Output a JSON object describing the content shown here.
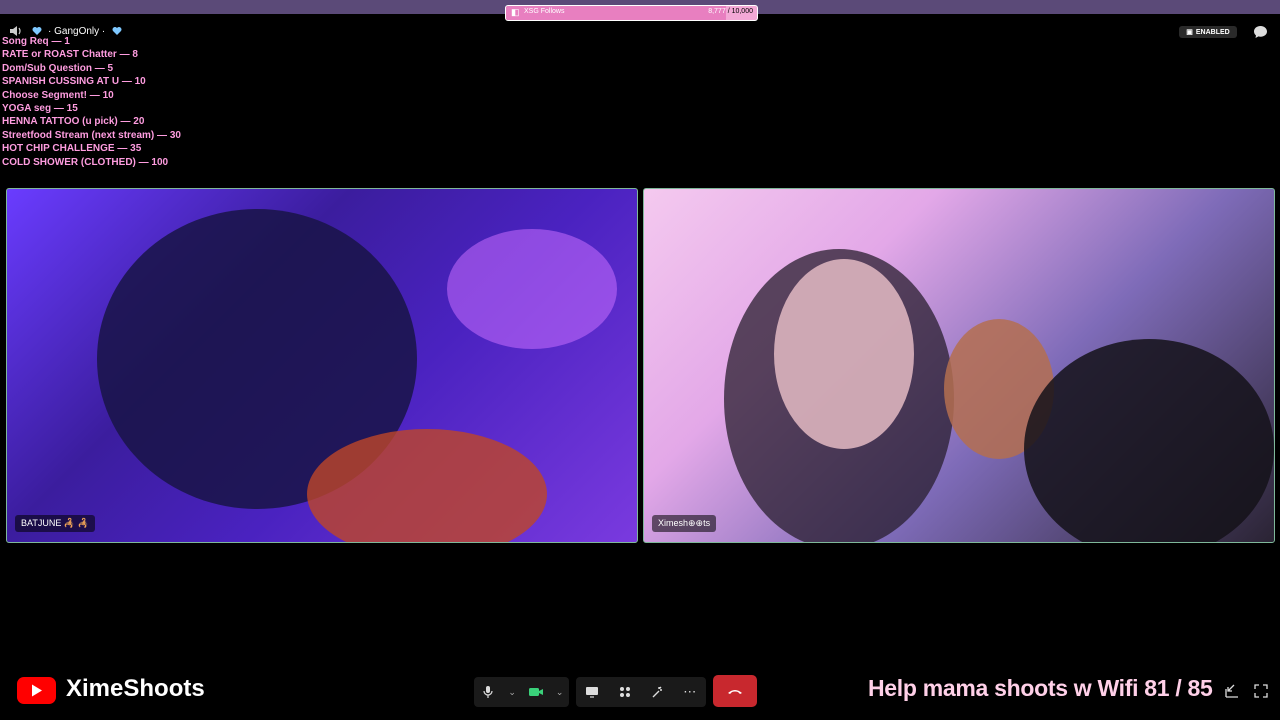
{
  "goal": {
    "label": "XSG Follows",
    "current": "8,777",
    "target": "/ 10,000",
    "progress": 0.8777
  },
  "header": {
    "gang_label": "· GangOnly ·",
    "enabled_badge": "ENABLED"
  },
  "menu": [
    "Song Req — 1",
    "RATE or ROAST Chatter — 8",
    "Dom/Sub Question — 5",
    "SPANISH CUSSING AT U — 10",
    "Choose Segment! — 10",
    "YOGA seg — 15",
    "HENNA TATTOO (u pick) — 20",
    "Streetfood Stream (next stream) — 30",
    "HOT CHIP CHALLENGE — 35",
    "COLD SHOWER (CLOTHED) — 100"
  ],
  "participants": [
    {
      "name": "BATJUNE 🦂 🦂"
    },
    {
      "name": "Ximesh⊕⊕ts"
    }
  ],
  "footer": {
    "channel": "XimeShoots",
    "banner": "Help mama shoots w Wifi  81 / 85"
  },
  "icons": {
    "speaker": "speaker-icon",
    "heart": "heart-icon",
    "chat": "chat-bubble-icon",
    "mic": "microphone-icon",
    "camera": "camera-icon",
    "share": "screen-share-icon",
    "apps": "apps-icon",
    "effects": "effects-icon",
    "more": "more-icon",
    "leave": "end-call-icon",
    "minimize": "minimize-icon",
    "fullscreen": "fullscreen-icon"
  },
  "colors": {
    "accent_pink": "#ff9de0",
    "leave_red": "#c8282e",
    "youtube_red": "#ff0000",
    "heart_blue": "#7ec8ff"
  }
}
